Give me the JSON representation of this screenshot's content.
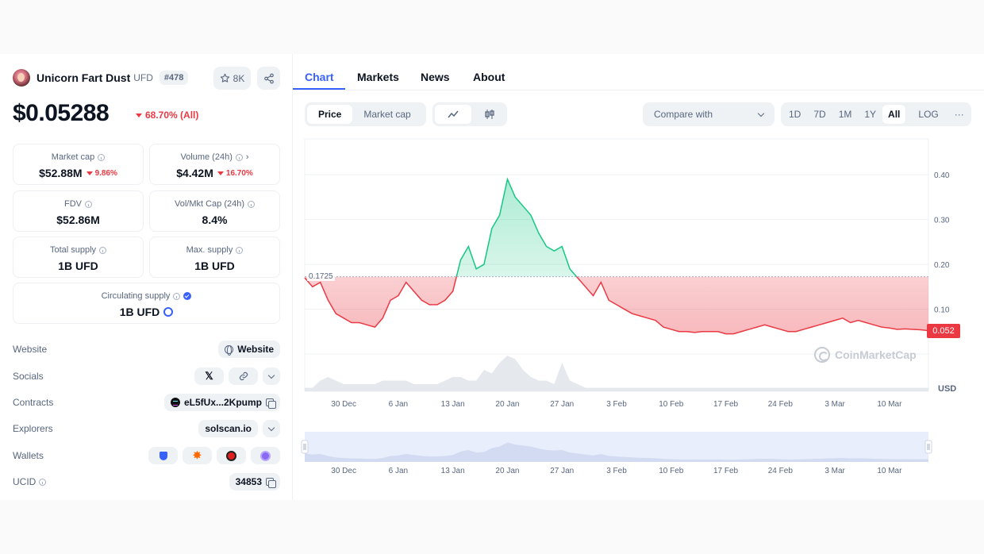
{
  "coin": {
    "name": "Unicorn Fart Dust",
    "symbol": "UFD",
    "rank": "#478",
    "watchlist_count": "8K",
    "price": "$0.05288",
    "price_change": "68.70% (All)"
  },
  "stats": {
    "market_cap": {
      "label": "Market cap",
      "value": "$52.88M",
      "change": "9.86%"
    },
    "volume": {
      "label": "Volume (24h)",
      "value": "$4.42M",
      "change": "16.70%"
    },
    "fdv": {
      "label": "FDV",
      "value": "$52.86M"
    },
    "vol_mkt_cap": {
      "label": "Vol/Mkt Cap (24h)",
      "value": "8.4%"
    },
    "total_supply": {
      "label": "Total supply",
      "value": "1B UFD"
    },
    "max_supply": {
      "label": "Max. supply",
      "value": "1B UFD"
    },
    "circulating_supply": {
      "label": "Circulating supply",
      "value": "1B UFD"
    }
  },
  "links": {
    "website": {
      "label": "Website",
      "button": "Website"
    },
    "socials": {
      "label": "Socials",
      "x_glyph": "𝕏",
      "link_icon": "link-icon"
    },
    "contracts": {
      "label": "Contracts",
      "address": "eL5fUx...2Kpump"
    },
    "explorers": {
      "label": "Explorers",
      "value": "solscan.io"
    },
    "wallets": {
      "label": "Wallets"
    },
    "ucid": {
      "label": "UCID",
      "value": "34853"
    }
  },
  "tabs": [
    "Chart",
    "Markets",
    "News",
    "About"
  ],
  "chart_controls": {
    "data_type": [
      "Price",
      "Market cap"
    ],
    "chart_style": [
      "line-icon",
      "candle-icon"
    ],
    "compare_placeholder": "Compare with",
    "ranges": [
      "1D",
      "7D",
      "1M",
      "1Y",
      "All",
      "LOG"
    ],
    "selected_range": "All",
    "more_glyph": "···"
  },
  "chart_data": {
    "type": "line",
    "title": "",
    "currency": "USD",
    "reference_value": 0.1725,
    "reference_label": "0.1725",
    "current_value": 0.052,
    "current_label": "0.052",
    "ylim": [
      0,
      0.48
    ],
    "y_ticks": [
      0.4,
      0.3,
      0.2,
      0.1
    ],
    "y_tick_labels": [
      "0.40",
      "0.30",
      "0.20",
      "0.10"
    ],
    "x_tick_labels": [
      "30 Dec",
      "6 Jan",
      "13 Jan",
      "20 Jan",
      "27 Jan",
      "3 Feb",
      "10 Feb",
      "17 Feb",
      "24 Feb",
      "3 Mar",
      "10 Mar"
    ],
    "x_dates": [
      "12-25",
      "12-26",
      "12-27",
      "12-28",
      "12-29",
      "12-30",
      "12-31",
      "01-01",
      "01-02",
      "01-03",
      "01-04",
      "01-05",
      "01-06",
      "01-07",
      "01-08",
      "01-09",
      "01-10",
      "01-11",
      "01-12",
      "01-13",
      "01-14",
      "01-15",
      "01-16",
      "01-17",
      "01-18",
      "01-19",
      "01-20",
      "01-21",
      "01-22",
      "01-23",
      "01-24",
      "01-25",
      "01-26",
      "01-27",
      "01-28",
      "01-29",
      "01-30",
      "01-31",
      "02-01",
      "02-02",
      "02-03",
      "02-04",
      "02-05",
      "02-06",
      "02-07",
      "02-08",
      "02-09",
      "02-10",
      "02-11",
      "02-12",
      "02-13",
      "02-14",
      "02-15",
      "02-16",
      "02-17",
      "02-18",
      "02-19",
      "02-20",
      "02-21",
      "02-22",
      "02-23",
      "02-24",
      "02-25",
      "02-26",
      "02-27",
      "02-28",
      "03-01",
      "03-02",
      "03-03",
      "03-04",
      "03-05",
      "03-06",
      "03-07",
      "03-08",
      "03-09",
      "03-10",
      "03-11",
      "03-12",
      "03-13",
      "03-14",
      "03-15"
    ],
    "values": [
      0.17,
      0.15,
      0.16,
      0.12,
      0.09,
      0.08,
      0.07,
      0.07,
      0.065,
      0.06,
      0.08,
      0.12,
      0.13,
      0.16,
      0.14,
      0.12,
      0.11,
      0.11,
      0.12,
      0.14,
      0.21,
      0.24,
      0.19,
      0.2,
      0.28,
      0.31,
      0.39,
      0.35,
      0.33,
      0.31,
      0.27,
      0.24,
      0.23,
      0.24,
      0.19,
      0.17,
      0.15,
      0.13,
      0.16,
      0.12,
      0.11,
      0.1,
      0.09,
      0.085,
      0.08,
      0.075,
      0.06,
      0.055,
      0.05,
      0.05,
      0.048,
      0.05,
      0.05,
      0.05,
      0.045,
      0.045,
      0.05,
      0.055,
      0.06,
      0.065,
      0.06,
      0.055,
      0.05,
      0.05,
      0.055,
      0.06,
      0.065,
      0.07,
      0.075,
      0.08,
      0.07,
      0.075,
      0.07,
      0.065,
      0.06,
      0.058,
      0.055,
      0.056,
      0.055,
      0.054,
      0.052
    ],
    "volume": [
      0.1,
      0.1,
      0.3,
      0.4,
      0.3,
      0.2,
      0.2,
      0.2,
      0.2,
      0.2,
      0.3,
      0.3,
      0.3,
      0.3,
      0.2,
      0.2,
      0.2,
      0.2,
      0.3,
      0.4,
      0.4,
      0.3,
      0.3,
      0.6,
      0.5,
      0.8,
      1.0,
      0.9,
      0.6,
      0.4,
      0.3,
      0.3,
      0.2,
      0.8,
      0.3,
      0.2,
      0.1,
      0.1,
      0.1,
      0.1,
      0.1,
      0.1,
      0.1,
      0.1,
      0.1,
      0.1,
      0.1,
      0.1,
      0.1,
      0.1,
      0.1,
      0.1,
      0.1,
      0.1,
      0.1,
      0.1,
      0.1,
      0.1,
      0.1,
      0.1,
      0.1,
      0.1,
      0.1,
      0.1,
      0.1,
      0.1,
      0.1,
      0.1,
      0.1,
      0.1,
      0.1,
      0.1,
      0.1,
      0.1,
      0.1,
      0.1,
      0.1,
      0.1,
      0.1,
      0.1,
      0.1
    ],
    "grid": true,
    "up_color": "#16c784",
    "down_color": "#ea3943",
    "watermark": "CoinMarketCap"
  }
}
